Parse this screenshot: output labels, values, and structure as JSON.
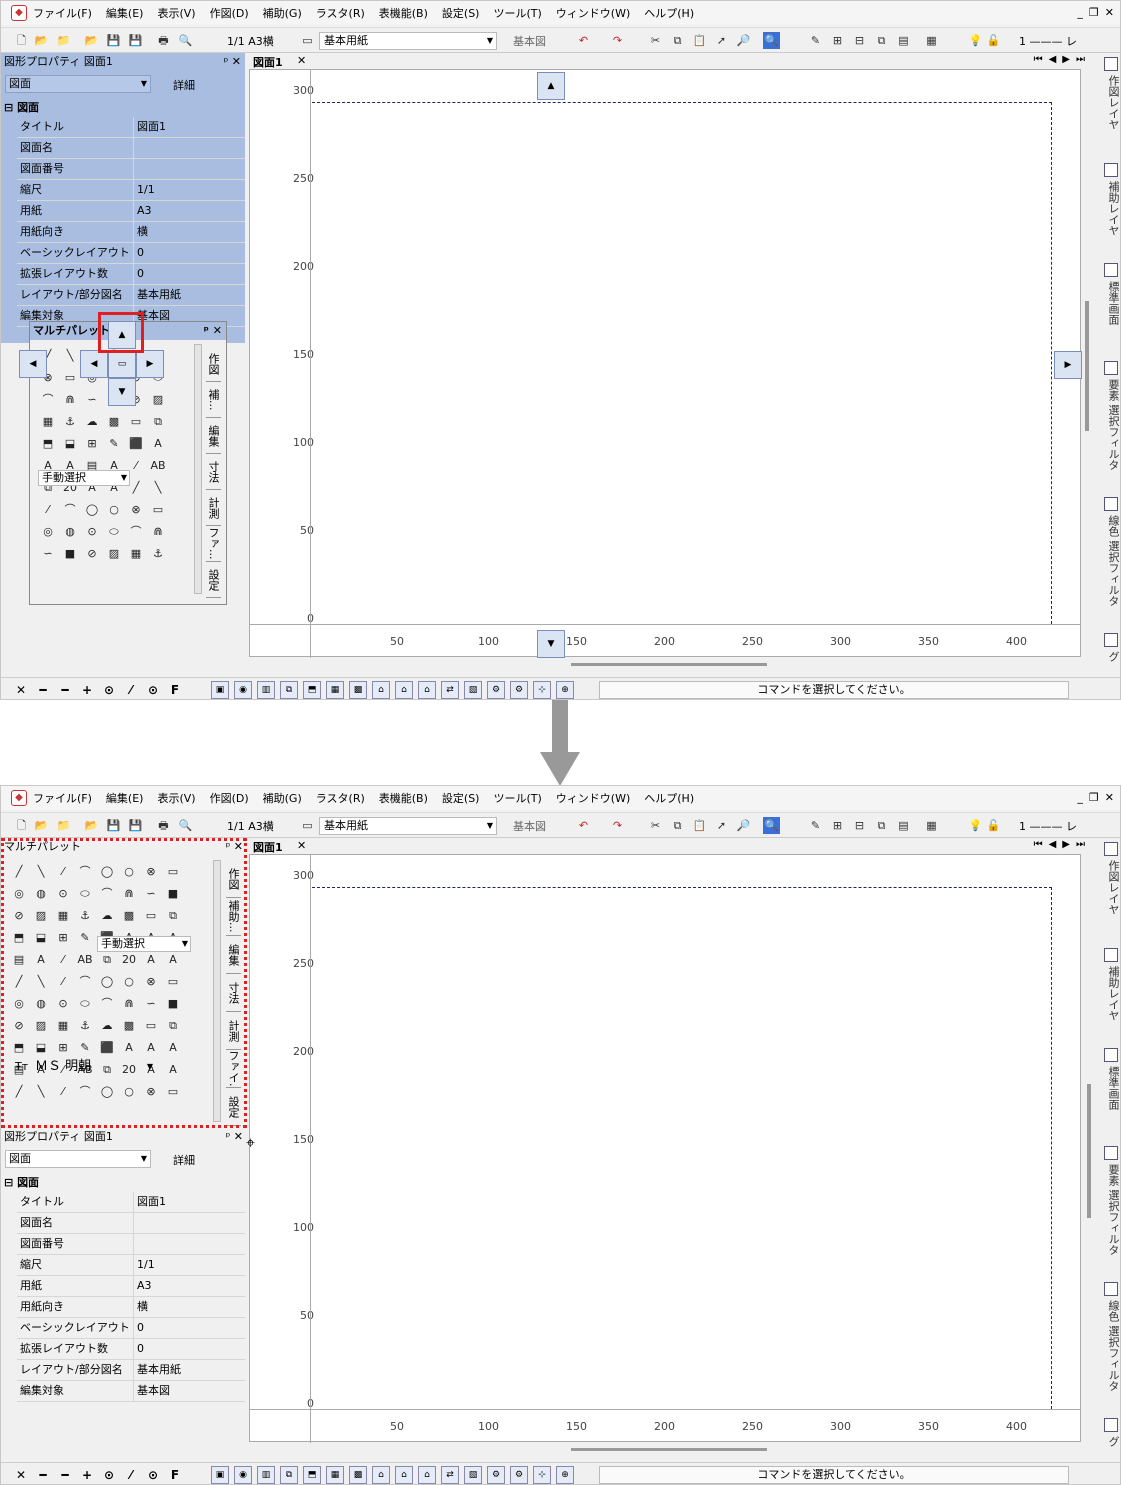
{
  "menu": [
    "ファイル(F)",
    "編集(E)",
    "表示(V)",
    "作図(D)",
    "補助(G)",
    "ラスタ(R)",
    "表機能(B)",
    "設定(S)",
    "ツール(T)",
    "ウィンドウ(W)",
    "ヘルプ(H)"
  ],
  "toolbar": {
    "scale_label": "1/1 A3横",
    "paper_label": "基本用紙",
    "layer_label": "基本図",
    "line_label": "1 ——— レ"
  },
  "property_panel": {
    "title": "図形プロパティ 図面1",
    "combo_value": "図面",
    "detail_button": "詳細",
    "group": "図面",
    "rows": [
      {
        "key": "タイトル",
        "value": "図面1"
      },
      {
        "key": "図面名",
        "value": ""
      },
      {
        "key": "図面番号",
        "value": ""
      },
      {
        "key": "縮尺",
        "value": "1/1"
      },
      {
        "key": "用紙",
        "value": "A3"
      },
      {
        "key": "用紙向き",
        "value": "横"
      },
      {
        "key": "ベーシックレイアウト数",
        "value": "0"
      },
      {
        "key": "拡張レイアウト数",
        "value": "0"
      },
      {
        "key": "レイアウト/部分図名",
        "value": "基本用紙"
      },
      {
        "key": "編集対象",
        "value": "基本図"
      }
    ]
  },
  "palette": {
    "title": "マルチパレット",
    "select_mode": "手動選択",
    "font_name": "ＭＳ 明朝",
    "tabs": [
      "作図",
      "補助...",
      "編集",
      "寸法",
      "計測",
      "ファイ...",
      "設定"
    ],
    "tabs_short": [
      "作図",
      "補...",
      "編集",
      "寸法",
      "計測",
      "ファ...",
      "設定"
    ]
  },
  "document": {
    "tab": "図面1",
    "y_ticks": [
      "300",
      "250",
      "200",
      "150",
      "100",
      "50",
      "0"
    ],
    "x_ticks": [
      "50",
      "100",
      "150",
      "200",
      "250",
      "300",
      "350",
      "400"
    ]
  },
  "right_tabs": [
    "作図レイヤ",
    "補助レイヤ",
    "標準画面",
    "要素 選択フィルタ",
    "線色 選択フィルタ",
    "グ"
  ],
  "status": {
    "message": "コマンドを選択してください。"
  },
  "snap_icons": [
    "✕",
    "━",
    "━",
    "+",
    "⊙",
    "⁄",
    "⊙",
    "F"
  ],
  "highlight_colors": {
    "marker": "#e02020",
    "panel_bg": "#a8bde0",
    "accent": "#3b5998"
  }
}
